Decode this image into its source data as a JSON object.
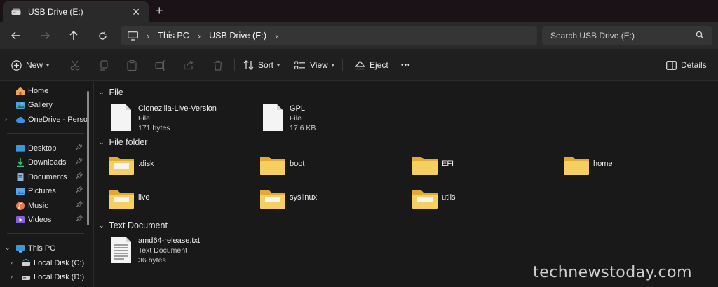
{
  "tab": {
    "title": "USB Drive (E:)",
    "close": "✕",
    "new_tab": "+"
  },
  "address": {
    "root_icon": "monitor-icon",
    "crumbs": [
      "This PC",
      "USB Drive (E:)"
    ],
    "separator": "›"
  },
  "search": {
    "placeholder": "Search USB Drive (E:)"
  },
  "toolbar": {
    "new_label": "New",
    "sort_label": "Sort",
    "view_label": "View",
    "eject_label": "Eject",
    "more_label": "•••",
    "details_label": "Details",
    "disabled_actions": [
      "cut-icon",
      "copy-icon",
      "paste-icon",
      "rename-icon",
      "share-icon",
      "delete-icon"
    ]
  },
  "sidebar": {
    "items": [
      {
        "label": "Home",
        "icon": "home-icon"
      },
      {
        "label": "Gallery",
        "icon": "gallery-icon"
      },
      {
        "label": "OneDrive - Persor",
        "icon": "cloud-icon"
      },
      {
        "label": "Desktop",
        "icon": "desktop-icon"
      },
      {
        "label": "Downloads",
        "icon": "download-icon"
      },
      {
        "label": "Documents",
        "icon": "documents-icon"
      },
      {
        "label": "Pictures",
        "icon": "pictures-icon"
      },
      {
        "label": "Music",
        "icon": "music-icon"
      },
      {
        "label": "Videos",
        "icon": "videos-icon"
      },
      {
        "label": "This PC",
        "icon": "monitor-icon"
      },
      {
        "label": "Local Disk (C:)",
        "icon": "drive-icon"
      },
      {
        "label": "Local Disk (D:)",
        "icon": "drive-icon"
      }
    ]
  },
  "groups": {
    "file": {
      "title": "File",
      "items": [
        {
          "name": "Clonezilla-Live-Version",
          "type": "File",
          "size": "171 bytes"
        },
        {
          "name": "GPL",
          "type": "File",
          "size": "17.6 KB"
        }
      ]
    },
    "file_folder": {
      "title": "File folder",
      "items": [
        ".disk",
        "boot",
        "EFI",
        "home",
        "live",
        "syslinux",
        "utils"
      ]
    },
    "text_document": {
      "title": "Text Document",
      "items": [
        {
          "name": "amd64-release.txt",
          "type": "Text Document",
          "size": "36 bytes"
        }
      ]
    }
  },
  "colors": {
    "folder": "#f2c94c",
    "accent": "#4aa3df",
    "background": "#191919"
  },
  "watermark": "technewstoday.com"
}
